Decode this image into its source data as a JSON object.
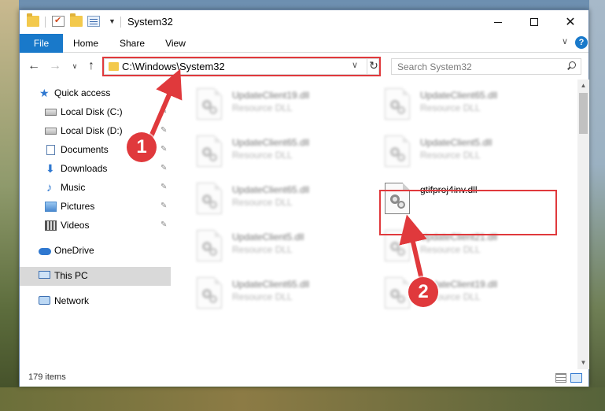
{
  "window": {
    "title": "System32"
  },
  "ribbon": {
    "tabs": [
      "File",
      "Home",
      "Share",
      "View"
    ],
    "help": "?"
  },
  "nav": {
    "back": "←",
    "forward": "→",
    "recent": "∨",
    "up": "↑",
    "address": "C:\\Windows\\System32",
    "refresh": "↻",
    "search_placeholder": "Search System32"
  },
  "sidebar": {
    "items": [
      {
        "label": "Quick access",
        "icon": "star-icon"
      },
      {
        "label": "Local Disk (C:)",
        "icon": "drive-icon",
        "pinned": true
      },
      {
        "label": "Local Disk (D:)",
        "icon": "drive-icon",
        "pinned": true
      },
      {
        "label": "Documents",
        "icon": "documents-icon",
        "pinned": true
      },
      {
        "label": "Downloads",
        "icon": "downloads-icon",
        "pinned": true
      },
      {
        "label": "Music",
        "icon": "music-icon",
        "pinned": true
      },
      {
        "label": "Pictures",
        "icon": "pictures-icon",
        "pinned": true
      },
      {
        "label": "Videos",
        "icon": "videos-icon",
        "pinned": true
      },
      {
        "label": "OneDrive",
        "icon": "onedrive-icon"
      },
      {
        "label": "This PC",
        "icon": "this-pc-icon",
        "selected": true
      },
      {
        "label": "Network",
        "icon": "network-icon"
      }
    ]
  },
  "files": [
    {
      "name": "UpdateClient19.dll",
      "type": "Resource DLL",
      "blurred": true
    },
    {
      "name": "UpdateClient65.dll",
      "type": "Resource DLL",
      "blurred": true
    },
    {
      "name": "UpdateClient65.dll",
      "type": "Resource DLL",
      "blurred": true
    },
    {
      "name": "UpdateClient5.dll",
      "type": "Resource DLL",
      "blurred": true
    },
    {
      "name": "UpdateClient65.dll",
      "type": "Resource DLL",
      "blurred": true
    },
    {
      "name": "gtifproj4inv.dll",
      "type": "",
      "blurred": false
    },
    {
      "name": "UpdateClient5.dll",
      "type": "Resource DLL",
      "blurred": true
    },
    {
      "name": "UpdateClient21.dll",
      "type": "Resource DLL",
      "blurred": true
    },
    {
      "name": "UpdateClient65.dll",
      "type": "Resource DLL",
      "blurred": true
    },
    {
      "name": "UpdateClient19.dll",
      "type": "Resource DLL",
      "blurred": true
    }
  ],
  "status": {
    "item_count": "179 items"
  },
  "annotations": {
    "step1": "1",
    "step2": "2",
    "color": "#e0393c"
  }
}
